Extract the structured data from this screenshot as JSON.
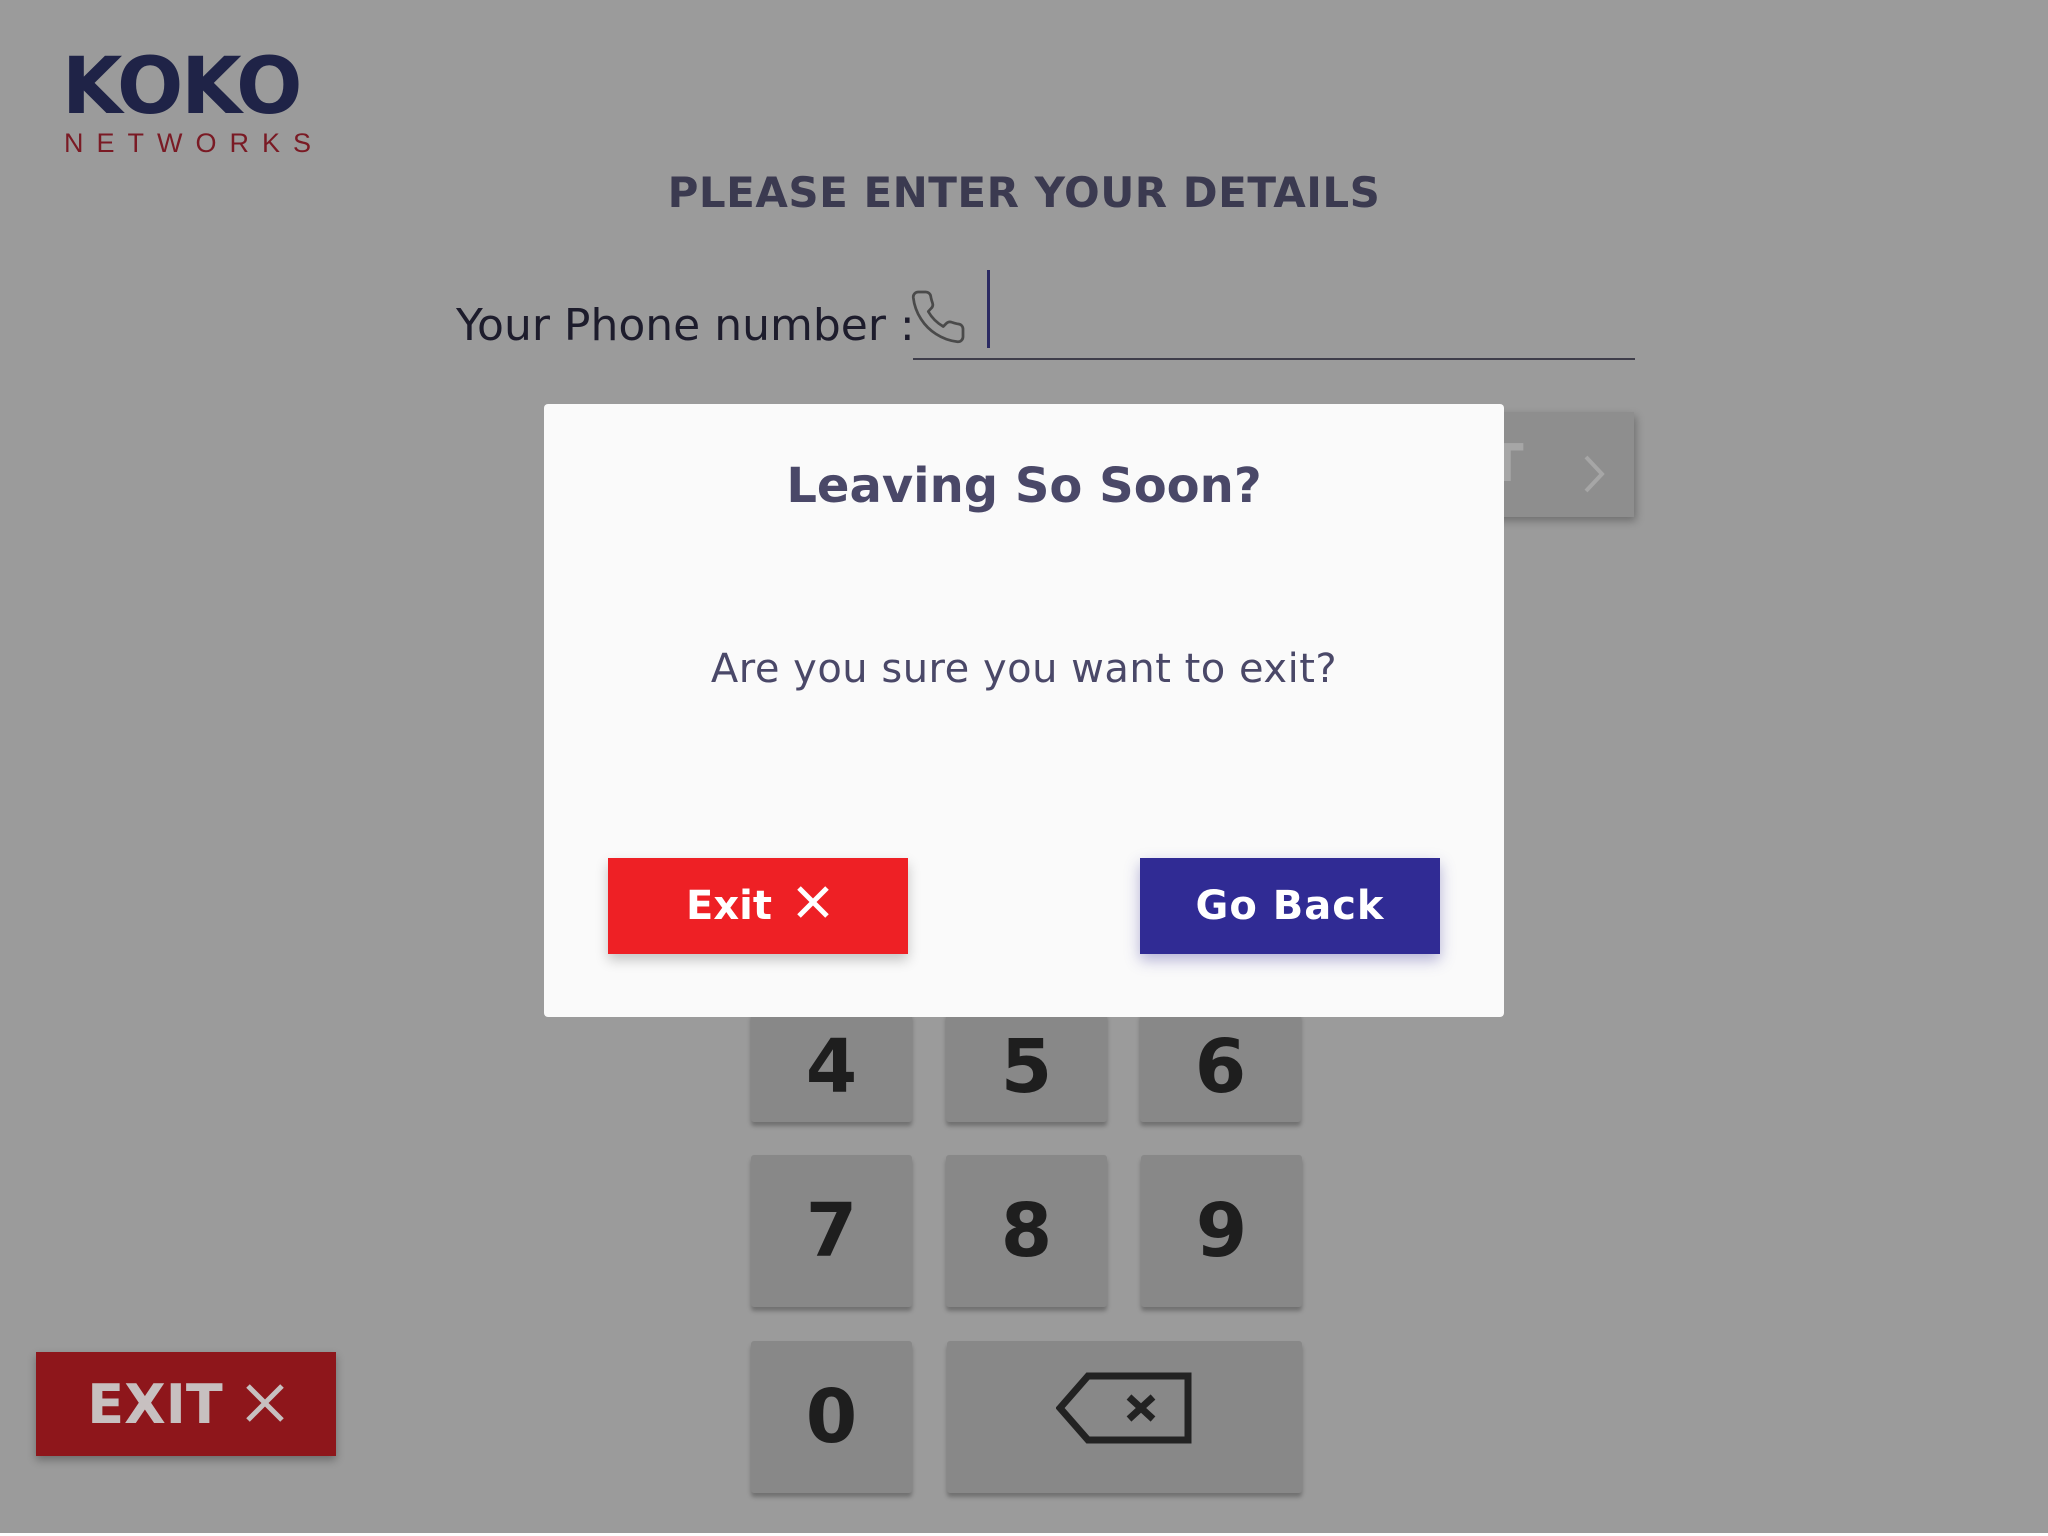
{
  "logo": {
    "brand": "KOKO",
    "subbrand": "NETWORKS"
  },
  "page": {
    "title": "PLEASE ENTER YOUR DETAILS",
    "phone_label": "Your Phone number :",
    "phone_value": ""
  },
  "next_button": {
    "label_visible": "XT",
    "icon": "chevron-right-icon"
  },
  "keypad": {
    "keys": [
      "4",
      "5",
      "6",
      "7",
      "8",
      "9",
      "0"
    ],
    "backspace_icon": "backspace-icon"
  },
  "exit_button": {
    "label": "EXIT",
    "icon": "close-icon"
  },
  "modal": {
    "title": "Leaving So Soon?",
    "message": "Are you sure you want to exit?",
    "exit_label": "Exit",
    "go_back_label": "Go Back"
  },
  "colors": {
    "overlay_bg": "#9b9b9b",
    "brand_navy": "#1f2347",
    "brand_red": "#7a1a24",
    "exit_red": "#ee2025",
    "go_back_blue": "#302b94"
  }
}
